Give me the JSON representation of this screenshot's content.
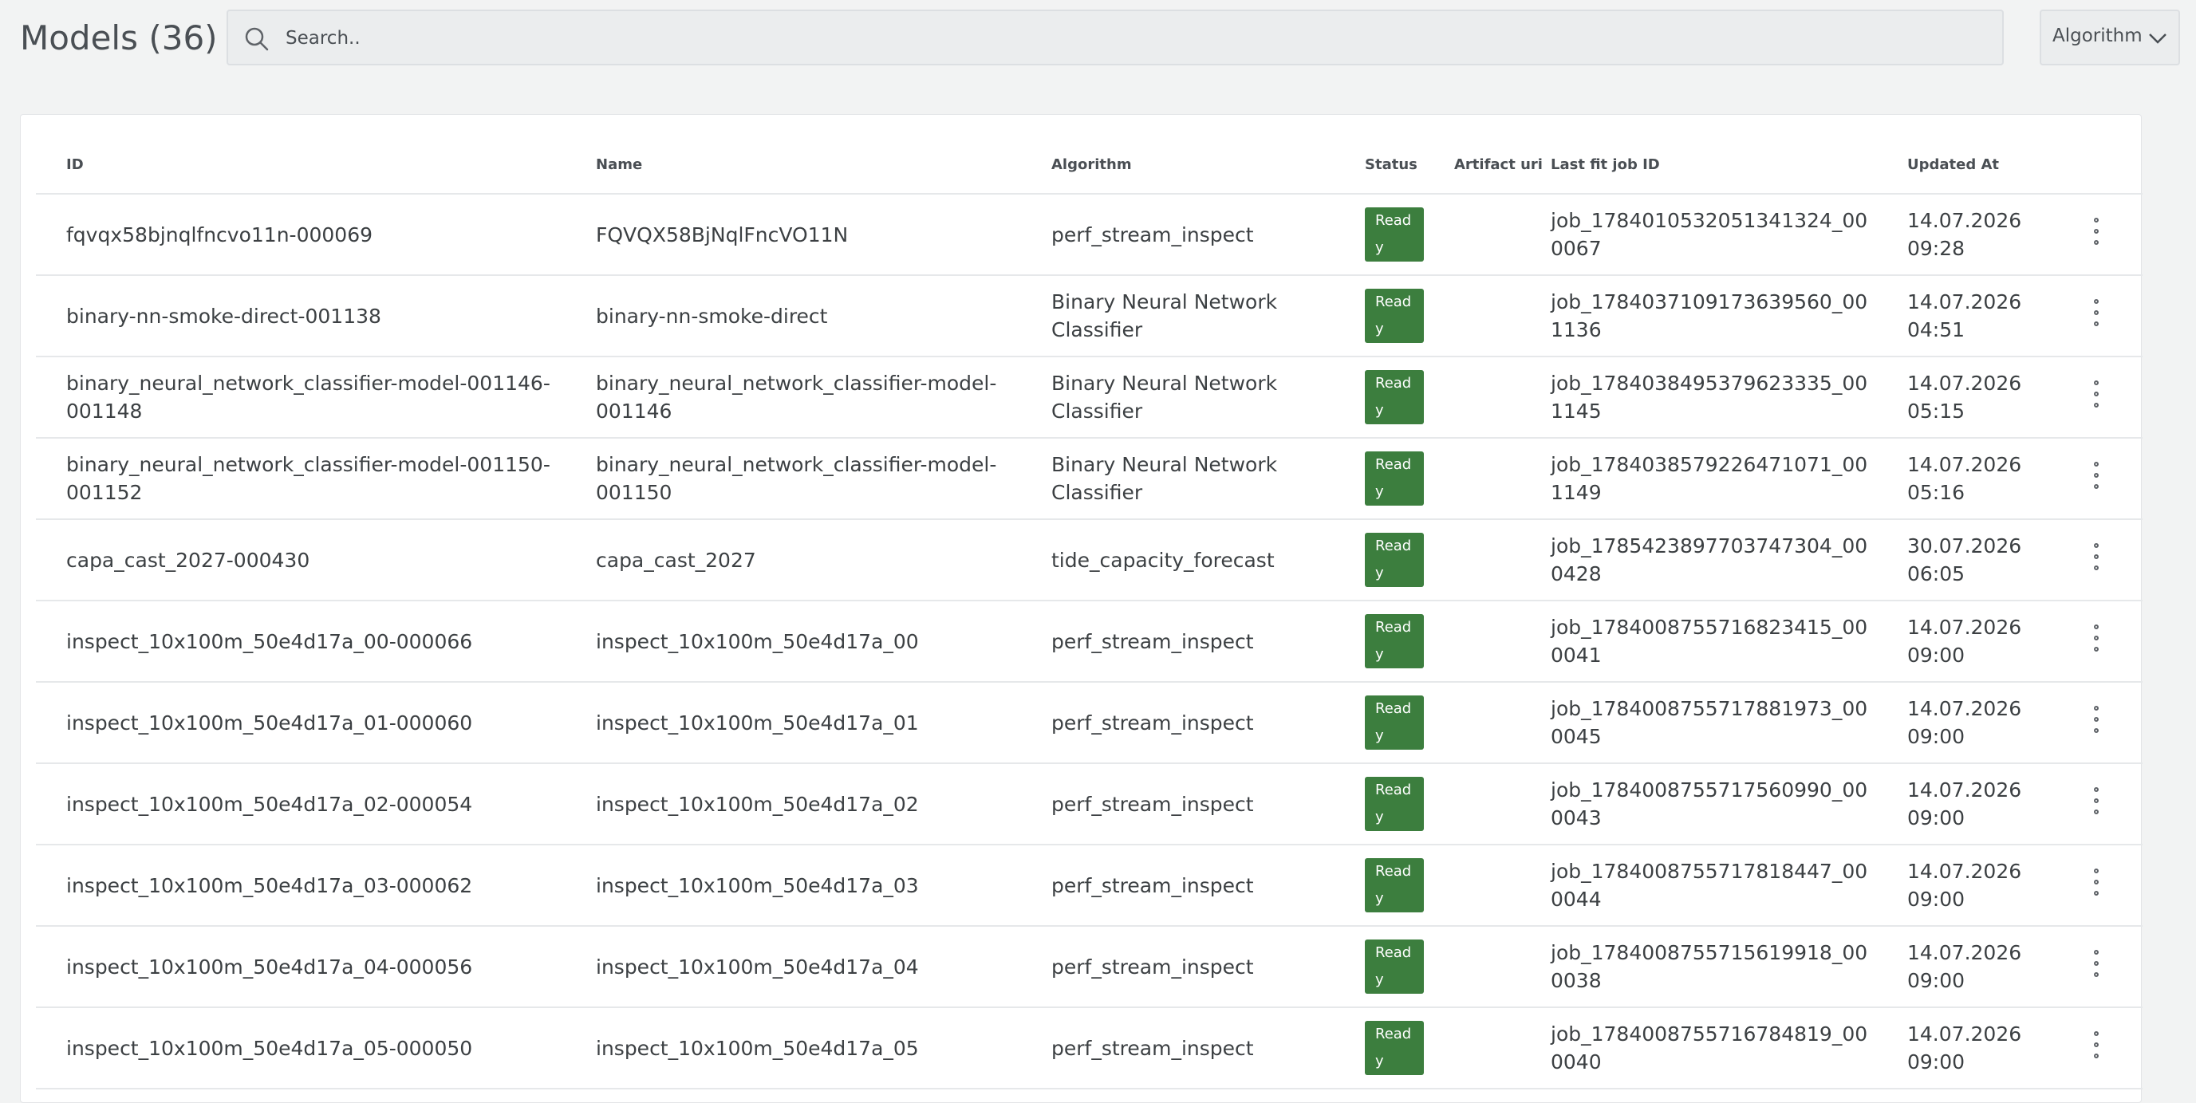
{
  "header": {
    "title": "Models (36)",
    "search_placeholder": "Search..",
    "algorithm_filter_label": "Algorithm"
  },
  "icons": {
    "search": "search-icon",
    "dropdown": "chevron-down-icon",
    "row_menu": "kebab-menu-icon"
  },
  "colors": {
    "status_ready": "#3c7e3e",
    "background": "#f2f3f3"
  },
  "table": {
    "columns": [
      "ID",
      "Name",
      "Algorithm",
      "Status",
      "Artifact uri",
      "Last fit job ID",
      "Updated At"
    ],
    "rows": [
      {
        "id": "fqvqx58bjnqlfncvo11n-000069",
        "name": "FQVQX58BjNqlFncVO11N",
        "algorithm": "perf_stream_inspect",
        "status": "Ready",
        "artifact_uri": "",
        "job": "job_1784010532051341324_000067",
        "updated": "14.07.2026 09:28"
      },
      {
        "id": "binary-nn-smoke-direct-001138",
        "name": "binary-nn-smoke-direct",
        "algorithm": "Binary Neural Network Classifier",
        "status": "Ready",
        "artifact_uri": "",
        "job": "job_1784037109173639560_001136",
        "updated": "14.07.2026 04:51"
      },
      {
        "id": "binary_neural_network_classifier-model-001146-001148",
        "name": "binary_neural_network_classifier-model-001146",
        "algorithm": "Binary Neural Network Classifier",
        "status": "Ready",
        "artifact_uri": "",
        "job": "job_1784038495379623335_001145",
        "updated": "14.07.2026 05:15"
      },
      {
        "id": "binary_neural_network_classifier-model-001150-001152",
        "name": "binary_neural_network_classifier-model-001150",
        "algorithm": "Binary Neural Network Classifier",
        "status": "Ready",
        "artifact_uri": "",
        "job": "job_1784038579226471071_001149",
        "updated": "14.07.2026 05:16"
      },
      {
        "id": "capa_cast_2027-000430",
        "name": "capa_cast_2027",
        "algorithm": "tide_capacity_forecast",
        "status": "Ready",
        "artifact_uri": "",
        "job": "job_1785423897703747304_000428",
        "updated": "30.07.2026 06:05"
      },
      {
        "id": "inspect_10x100m_50e4d17a_00-000066",
        "name": "inspect_10x100m_50e4d17a_00",
        "algorithm": "perf_stream_inspect",
        "status": "Ready",
        "artifact_uri": "",
        "job": "job_1784008755716823415_000041",
        "updated": "14.07.2026 09:00"
      },
      {
        "id": "inspect_10x100m_50e4d17a_01-000060",
        "name": "inspect_10x100m_50e4d17a_01",
        "algorithm": "perf_stream_inspect",
        "status": "Ready",
        "artifact_uri": "",
        "job": "job_1784008755717881973_000045",
        "updated": "14.07.2026 09:00"
      },
      {
        "id": "inspect_10x100m_50e4d17a_02-000054",
        "name": "inspect_10x100m_50e4d17a_02",
        "algorithm": "perf_stream_inspect",
        "status": "Ready",
        "artifact_uri": "",
        "job": "job_1784008755717560990_000043",
        "updated": "14.07.2026 09:00"
      },
      {
        "id": "inspect_10x100m_50e4d17a_03-000062",
        "name": "inspect_10x100m_50e4d17a_03",
        "algorithm": "perf_stream_inspect",
        "status": "Ready",
        "artifact_uri": "",
        "job": "job_1784008755717818447_000044",
        "updated": "14.07.2026 09:00"
      },
      {
        "id": "inspect_10x100m_50e4d17a_04-000056",
        "name": "inspect_10x100m_50e4d17a_04",
        "algorithm": "perf_stream_inspect",
        "status": "Ready",
        "artifact_uri": "",
        "job": "job_1784008755715619918_000038",
        "updated": "14.07.2026 09:00"
      },
      {
        "id": "inspect_10x100m_50e4d17a_05-000050",
        "name": "inspect_10x100m_50e4d17a_05",
        "algorithm": "perf_stream_inspect",
        "status": "Ready",
        "artifact_uri": "",
        "job": "job_1784008755716784819_000040",
        "updated": "14.07.2026 09:00"
      }
    ]
  }
}
